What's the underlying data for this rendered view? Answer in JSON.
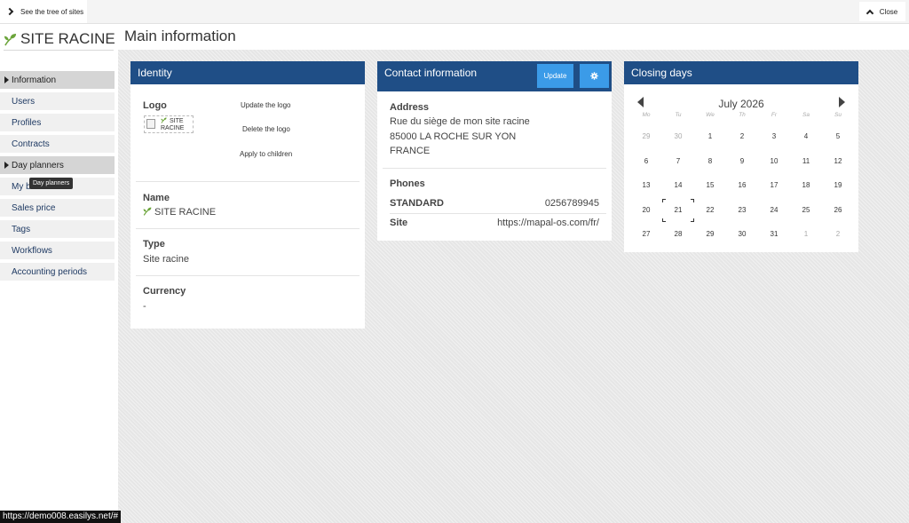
{
  "topbar": {
    "tree_label": "See the tree of sites",
    "close_label": "Close"
  },
  "brand": {
    "name": "SITE RACINE"
  },
  "page_title": "Main information",
  "sidebar": {
    "items": [
      {
        "label": "Information",
        "active": true,
        "expanded": true
      },
      {
        "label": "Users"
      },
      {
        "label": "Profiles"
      },
      {
        "label": "Contracts"
      },
      {
        "label": "Day planners",
        "active": true,
        "expanded": true
      },
      {
        "label": "My b"
      },
      {
        "label": "Sales price"
      },
      {
        "label": "Tags"
      },
      {
        "label": "Workflows"
      },
      {
        "label": "Accounting periods"
      }
    ],
    "tooltip": "Day planners"
  },
  "identity": {
    "title": "Identity",
    "logo_label": "Logo",
    "logo_alt_line1": "SITE",
    "logo_alt_line2": "RACINE",
    "update_logo": "Update the logo",
    "delete_logo": "Delete the logo",
    "apply_children": "Apply to children",
    "name_label": "Name",
    "name_value": "SITE RACINE",
    "type_label": "Type",
    "type_value": "Site racine",
    "currency_label": "Currency",
    "currency_value": "-"
  },
  "contact": {
    "title": "Contact information",
    "update_button": "Update",
    "address_label": "Address",
    "address_lines": [
      "Rue du siège de mon site racine",
      "85000 LA ROCHE SUR YON",
      "FRANCE"
    ],
    "phones_label": "Phones",
    "phones": [
      {
        "label": "STANDARD",
        "value": "0256789945"
      },
      {
        "label": "Site",
        "value": "https://mapal-os.com/fr/"
      }
    ]
  },
  "closing": {
    "title": "Closing days",
    "month": "July 2026",
    "weekdays": [
      "Mo",
      "Tu",
      "We",
      "Th",
      "Fr",
      "Sa",
      "Su"
    ],
    "weeks": [
      [
        {
          "d": "29",
          "m": true
        },
        {
          "d": "30",
          "m": true
        },
        {
          "d": "1"
        },
        {
          "d": "2"
        },
        {
          "d": "3"
        },
        {
          "d": "4"
        },
        {
          "d": "5"
        }
      ],
      [
        {
          "d": "6"
        },
        {
          "d": "7"
        },
        {
          "d": "8"
        },
        {
          "d": "9"
        },
        {
          "d": "10"
        },
        {
          "d": "11"
        },
        {
          "d": "12"
        }
      ],
      [
        {
          "d": "13"
        },
        {
          "d": "14"
        },
        {
          "d": "15"
        },
        {
          "d": "16"
        },
        {
          "d": "17"
        },
        {
          "d": "18"
        },
        {
          "d": "19"
        }
      ],
      [
        {
          "d": "20"
        },
        {
          "d": "21",
          "t": true
        },
        {
          "d": "22"
        },
        {
          "d": "23"
        },
        {
          "d": "24"
        },
        {
          "d": "25"
        },
        {
          "d": "26"
        }
      ],
      [
        {
          "d": "27"
        },
        {
          "d": "28"
        },
        {
          "d": "29"
        },
        {
          "d": "30"
        },
        {
          "d": "31"
        },
        {
          "d": "1",
          "m": true
        },
        {
          "d": "2",
          "m": true
        }
      ]
    ]
  },
  "status_url": "https://demo008.easilys.net/#",
  "colors": {
    "header_blue": "#1f4e86",
    "button_blue": "#3b9be8",
    "leaf_green": "#6ba43a"
  }
}
